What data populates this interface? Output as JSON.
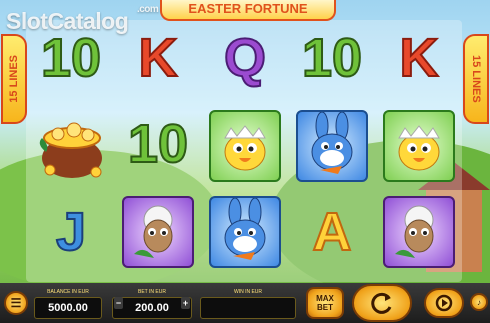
{
  "watermark": {
    "text": "SlotCatalog",
    "tld": ".com"
  },
  "game": {
    "title": "EASTER FORTUNE"
  },
  "lines_badge": {
    "left": "15 LINES",
    "right": "15 LINES"
  },
  "reels": {
    "rows": [
      [
        "10",
        "K",
        "Q",
        "10",
        "K"
      ],
      [
        "pot-of-gold",
        "10",
        "chick",
        "bunny",
        "chick"
      ],
      [
        "J",
        "lamb",
        "bunny",
        "A",
        "lamb"
      ]
    ]
  },
  "controls": {
    "balance_label": "BALANCE IN EUR",
    "balance_value": "5000.00",
    "bet_label": "BET IN EUR",
    "bet_value": "200.00",
    "bet_minus": "−",
    "bet_plus": "+",
    "win_label": "WIN IN EUR",
    "win_value": "",
    "max_bet_label": "MAX BET",
    "spin_icon": "refresh-icon",
    "autoplay_icon": "autoplay-icon"
  },
  "colors": {
    "accent": "#e0521c",
    "gold": "#f0a21a",
    "bar": "#1d1d1d"
  }
}
